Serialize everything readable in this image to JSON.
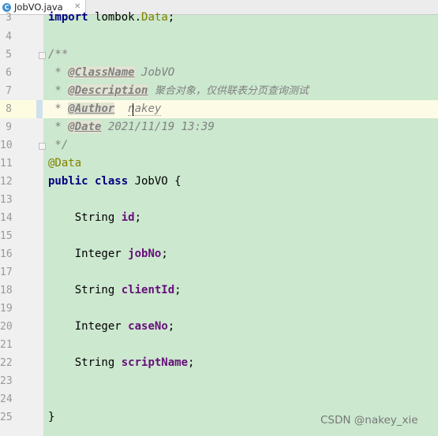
{
  "tab": {
    "icon_letter": "C",
    "label": "JobVO.java"
  },
  "lines": [
    {
      "num": "3",
      "text": "import lombok.Data;"
    },
    {
      "num": "4",
      "text": ""
    },
    {
      "num": "5",
      "text": "/**"
    },
    {
      "num": "6",
      "tag": "@ClassName",
      "value": "JobVO"
    },
    {
      "num": "7",
      "tag": "@Description",
      "value": "聚合对象，仅供联表分页查询测试"
    },
    {
      "num": "8",
      "tag": "@Author",
      "value": "nakey"
    },
    {
      "num": "9",
      "tag": "@Date",
      "value": "2021/11/19 13:39"
    },
    {
      "num": "10",
      "text": " */"
    },
    {
      "num": "11",
      "text": "@Data"
    },
    {
      "num": "12",
      "text": "public class JobVO {"
    },
    {
      "num": "13",
      "text": ""
    },
    {
      "num": "14",
      "type": "String",
      "field": "id"
    },
    {
      "num": "15",
      "text": ""
    },
    {
      "num": "16",
      "type": "Integer",
      "field": "jobNo"
    },
    {
      "num": "17",
      "text": ""
    },
    {
      "num": "18",
      "type": "String",
      "field": "clientId"
    },
    {
      "num": "19",
      "text": ""
    },
    {
      "num": "20",
      "type": "Integer",
      "field": "caseNo"
    },
    {
      "num": "21",
      "text": ""
    },
    {
      "num": "22",
      "type": "String",
      "field": "scriptName"
    },
    {
      "num": "23",
      "text": ""
    },
    {
      "num": "24",
      "text": ""
    },
    {
      "num": "25",
      "text": "}"
    }
  ],
  "watermark": "CSDN @nakey_xie",
  "colors": {
    "editor_bg": "#cce8cf",
    "keyword": "#000080",
    "field": "#660e7a",
    "annotation": "#808000",
    "comment": "#808080"
  }
}
